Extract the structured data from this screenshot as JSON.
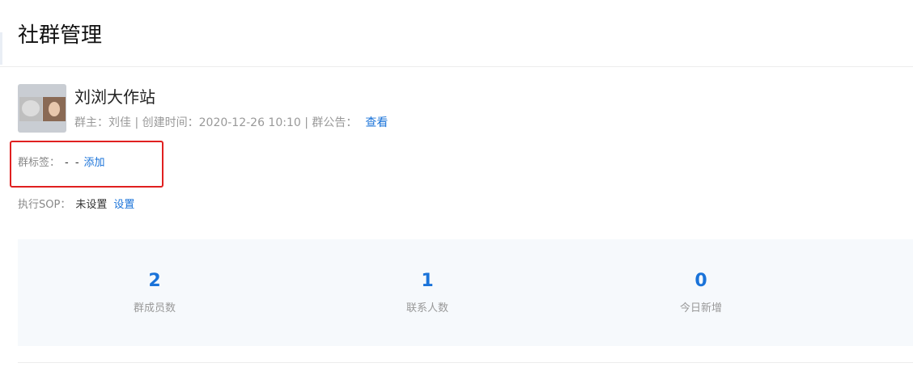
{
  "page": {
    "title": "社群管理"
  },
  "group": {
    "name": "刘浏大作站",
    "owner_label": "群主：",
    "owner": "刘佳",
    "separator": " | ",
    "created_label": "创建时间：",
    "created_at": "2020-12-26 10:10",
    "notice_label": "群公告：",
    "notice_link": "查看"
  },
  "tags": {
    "label": "群标签：",
    "value": "- -",
    "add_link": "添加"
  },
  "sop": {
    "label": "执行SOP：",
    "value": "未设置",
    "set_link": "设置"
  },
  "stats": [
    {
      "value": "2",
      "label": "群成员数"
    },
    {
      "value": "1",
      "label": "联系人数"
    },
    {
      "value": "0",
      "label": "今日新增"
    }
  ],
  "colors": {
    "accent": "#1a73d9",
    "highlight_border": "#e02020",
    "stats_bg": "#f6f9fc"
  }
}
